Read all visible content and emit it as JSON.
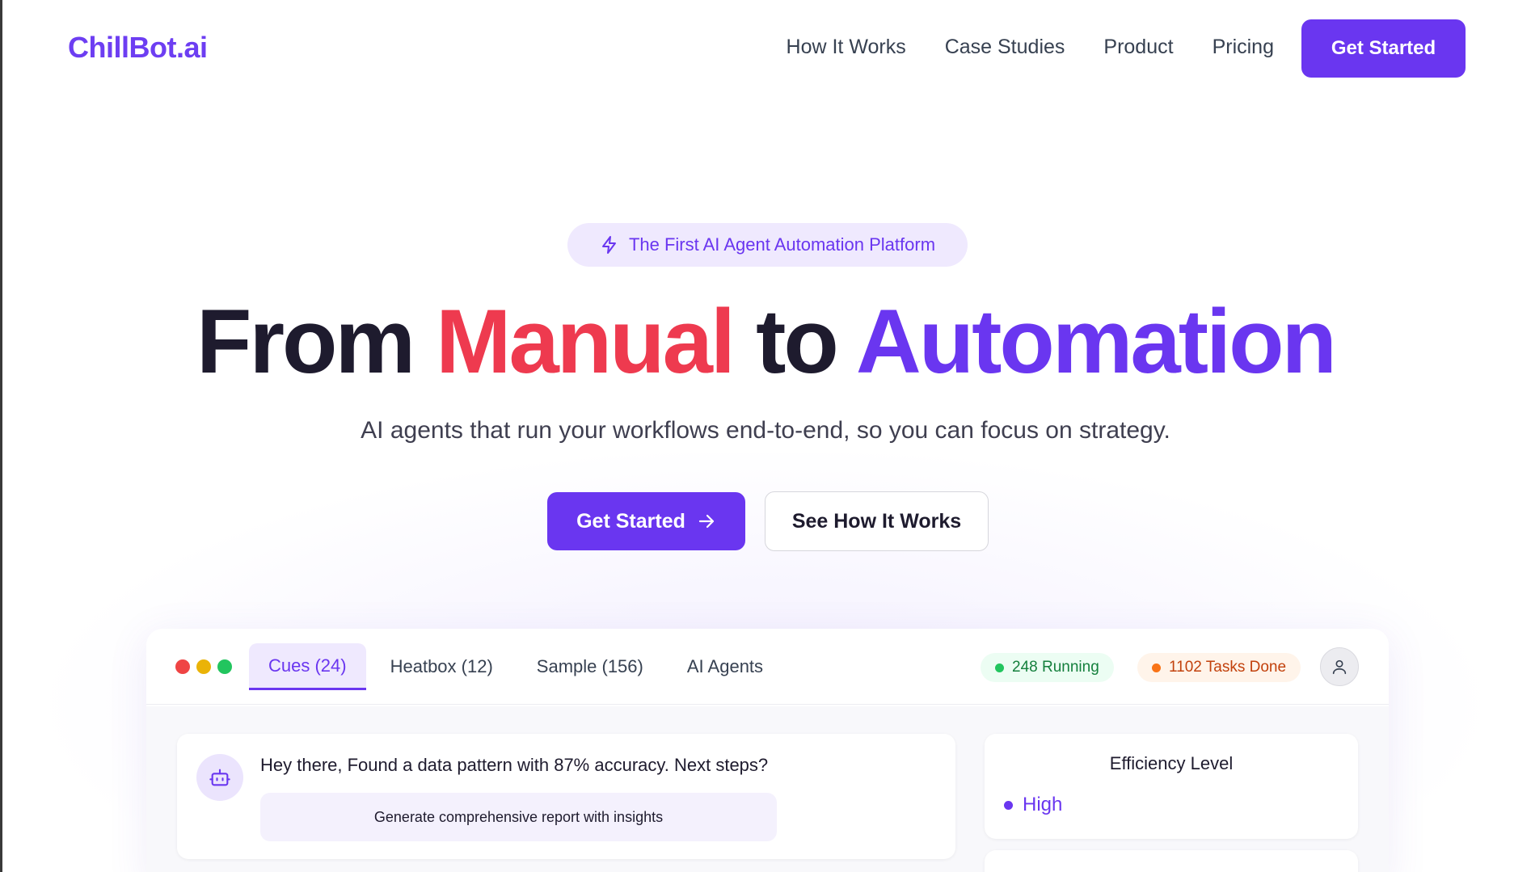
{
  "brand": {
    "logo_text": "ChillBot.ai",
    "accent": "#6a36f0",
    "red": "#ee3a4f"
  },
  "nav": {
    "items": [
      {
        "label": "How It Works"
      },
      {
        "label": "Case Studies"
      },
      {
        "label": "Product"
      },
      {
        "label": "Pricing"
      }
    ],
    "cta_label": "Get Started"
  },
  "hero": {
    "badge_icon": "lightning-icon",
    "badge_text": "The First AI Agent Automation Platform",
    "headline": {
      "part1": "From",
      "part2": "Manual",
      "part3": "to",
      "part4": "Automation"
    },
    "subtitle": "AI agents that run your workflows end-to-end, so you can focus on strategy.",
    "primary_button": "Get Started",
    "secondary_button": "See How It Works"
  },
  "dashboard": {
    "window_dots": [
      "#ef4444",
      "#eab308",
      "#22c55e"
    ],
    "tabs": [
      {
        "label": "Cues (24)",
        "active": true
      },
      {
        "label": "Heatbox (12)",
        "active": false
      },
      {
        "label": "Sample (156)",
        "active": false
      },
      {
        "label": "AI Agents",
        "active": false
      }
    ],
    "running": {
      "label": "248 Running",
      "color": "#22c55e"
    },
    "tasks_done": {
      "label": "1102 Tasks Done",
      "color": "#f97316"
    },
    "chat": {
      "message": "Hey there, Found a data pattern with 87% accuracy. Next steps?",
      "suggestion": "Generate comprehensive report with insights"
    },
    "efficiency": {
      "title": "Efficiency Level",
      "value": "High"
    }
  }
}
